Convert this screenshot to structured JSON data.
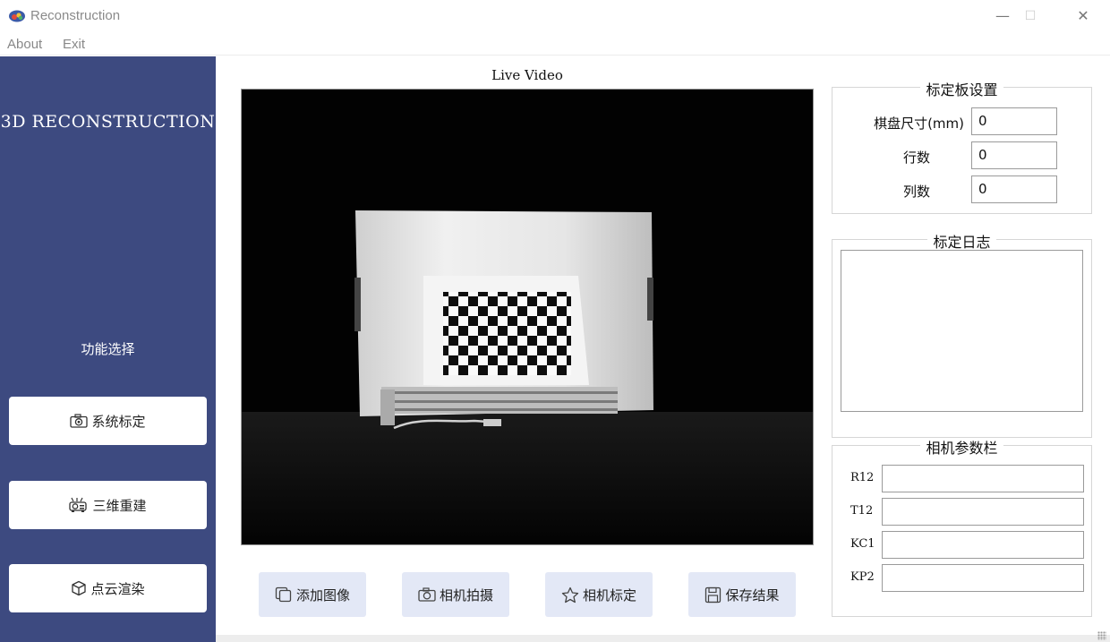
{
  "window": {
    "title": "Reconstruction",
    "minimize": "—",
    "maximize": "☐",
    "close": "✕"
  },
  "menu": [
    "About",
    "Exit"
  ],
  "sidebar": {
    "title": "3D RECONSTRUCTION",
    "section_label": "功能选择",
    "buttons": [
      {
        "label": "系统标定",
        "icon": "camera-icon"
      },
      {
        "label": "三维重建",
        "icon": "projector-icon"
      },
      {
        "label": "点云渲染",
        "icon": "cube-icon"
      }
    ],
    "bg_color": "#3d4a80"
  },
  "video": {
    "label": "Live Video"
  },
  "actions": [
    {
      "label": "添加图像",
      "icon": "add-image-icon"
    },
    {
      "label": "相机拍摄",
      "icon": "camera-icon"
    },
    {
      "label": "相机标定",
      "icon": "star-icon"
    },
    {
      "label": "保存结果",
      "icon": "save-icon"
    }
  ],
  "board_settings": {
    "title": "标定板设置",
    "fields": [
      {
        "label": "棋盘尺寸(mm)",
        "value": "0"
      },
      {
        "label": "行数",
        "value": "0"
      },
      {
        "label": "列数",
        "value": "0"
      }
    ]
  },
  "calib_log": {
    "title": "标定日志"
  },
  "camera_params": {
    "title": "相机参数栏",
    "fields": [
      {
        "label": "R12",
        "value": ""
      },
      {
        "label": "T12",
        "value": ""
      },
      {
        "label": "KC1",
        "value": ""
      },
      {
        "label": "KP2",
        "value": ""
      }
    ]
  }
}
